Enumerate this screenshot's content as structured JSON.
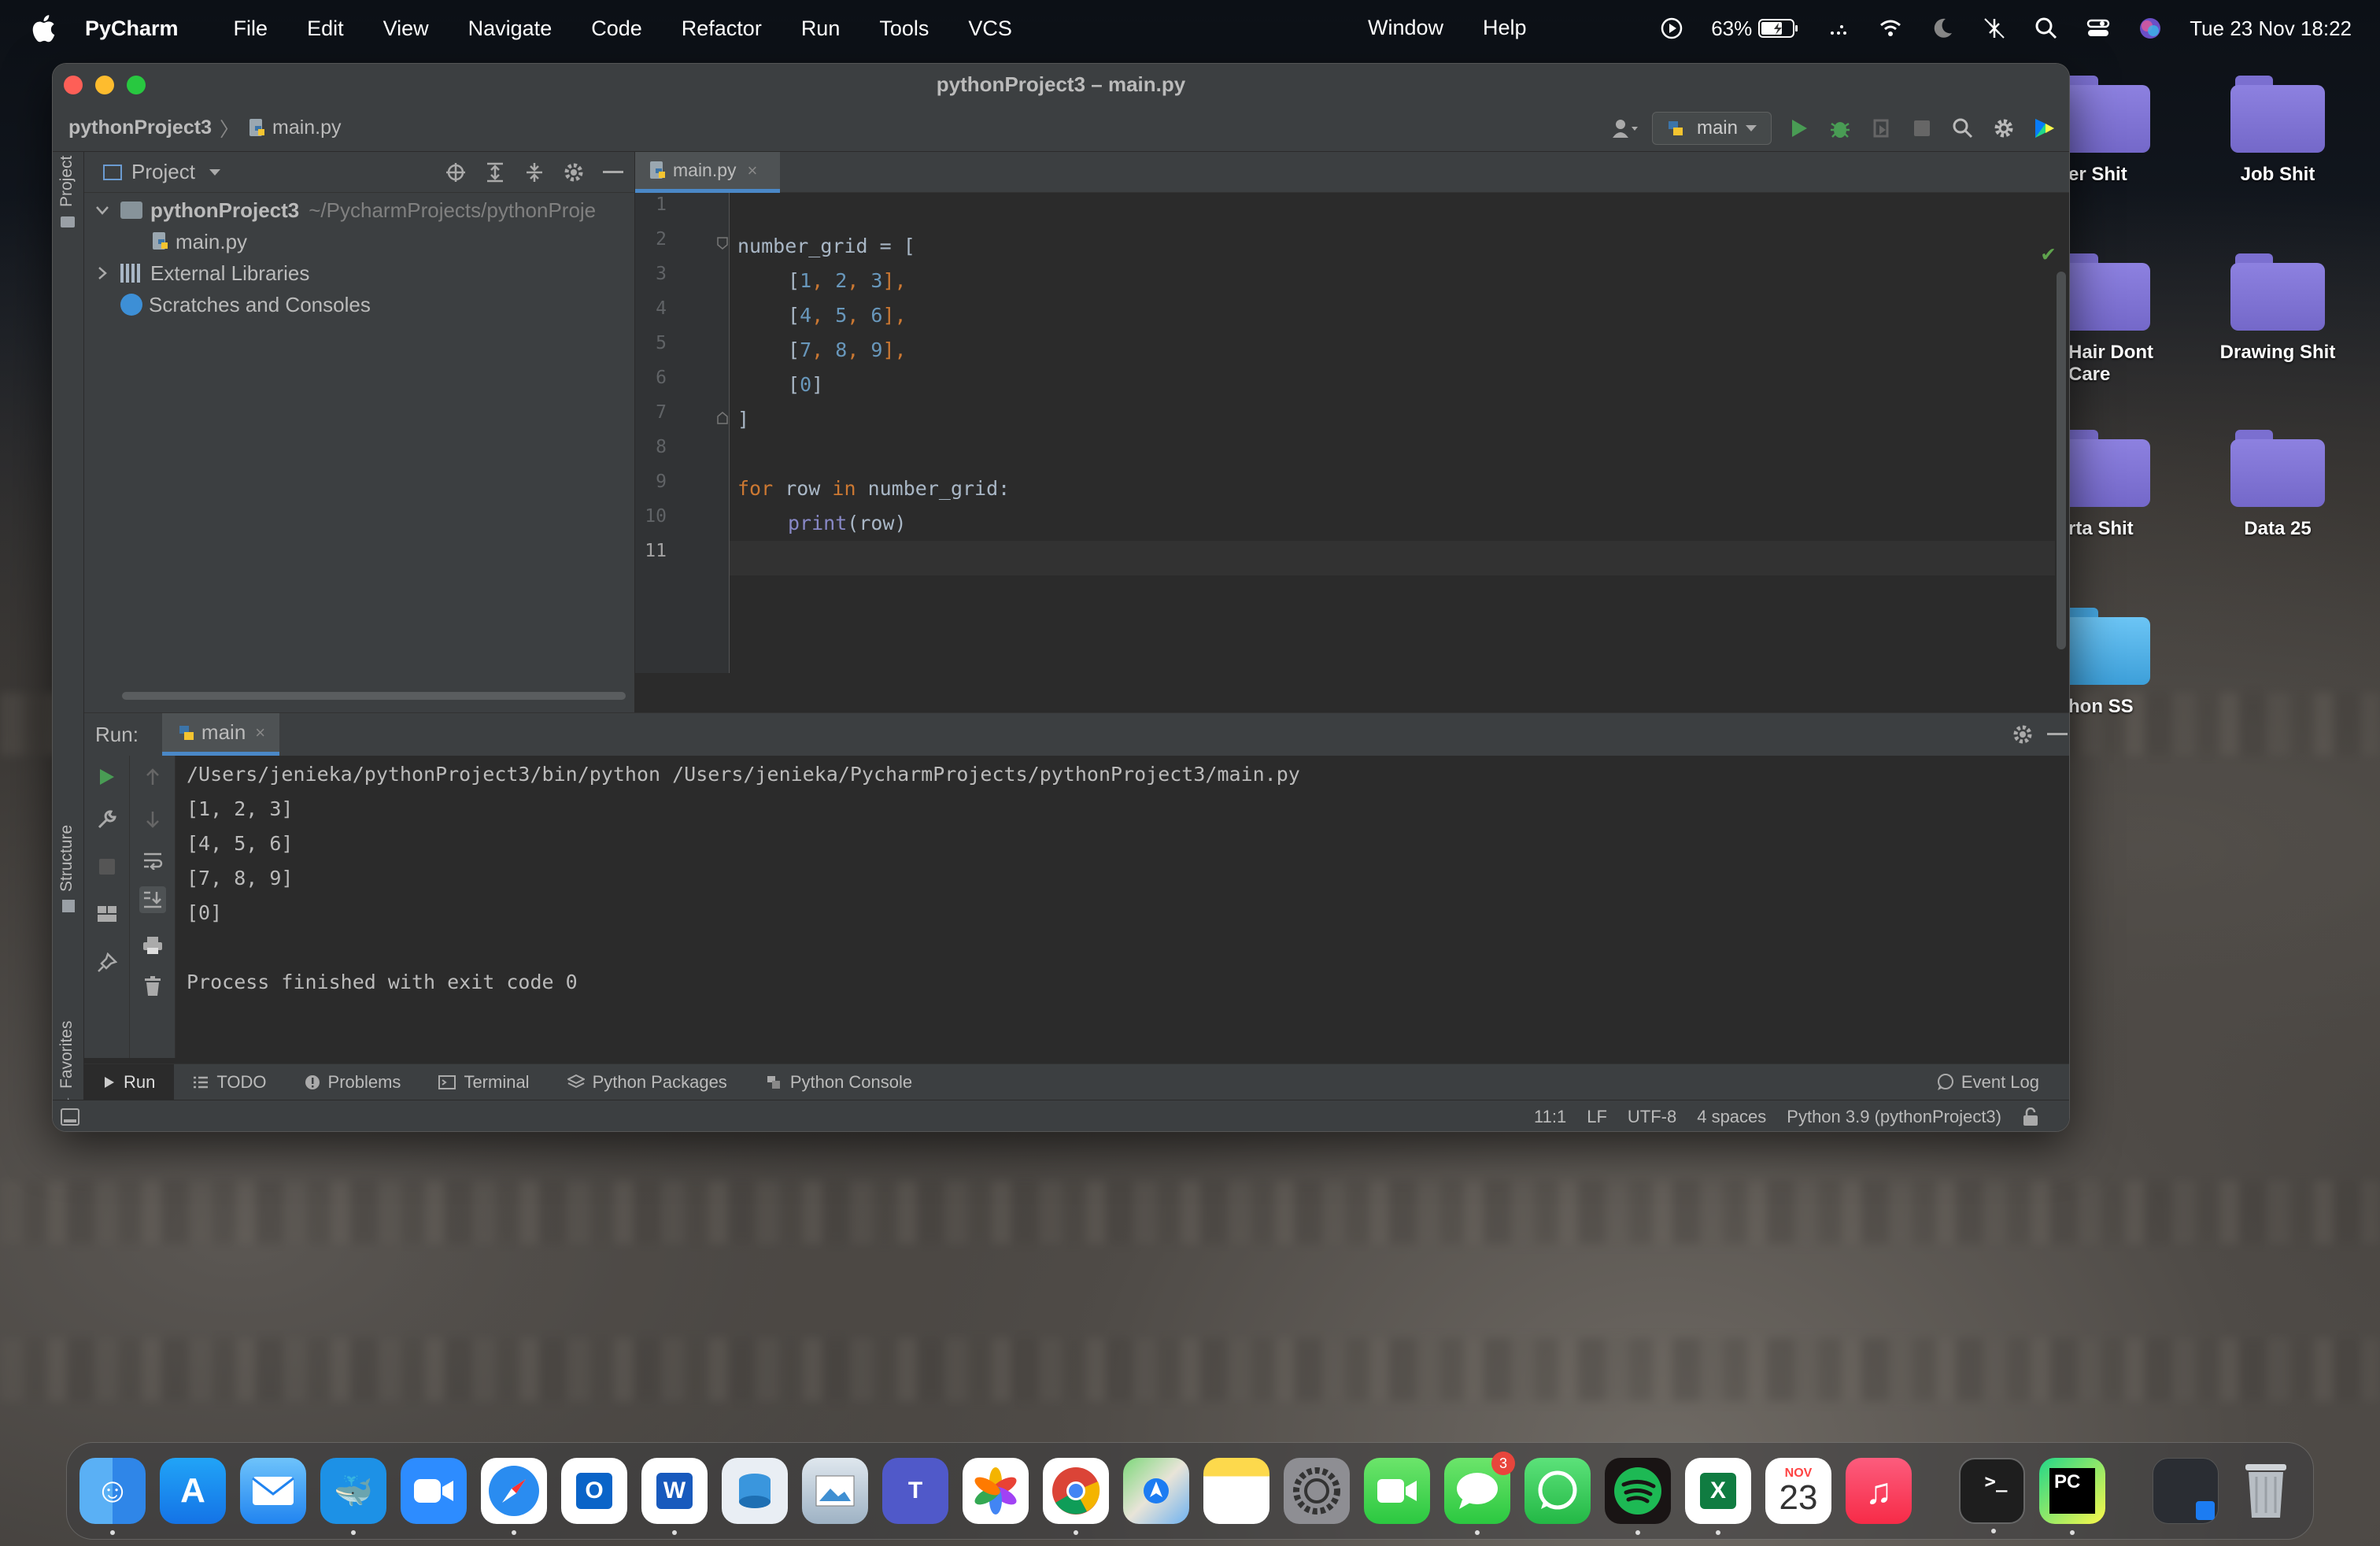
{
  "menubar": {
    "app_name": "PyCharm",
    "items": [
      "File",
      "Edit",
      "View",
      "Navigate",
      "Code",
      "Refactor",
      "Run",
      "Tools",
      "VCS"
    ],
    "window": "Window",
    "help": "Help",
    "battery": "63%",
    "datetime": "Tue 23 Nov  18:22"
  },
  "desktop": {
    "icons": [
      "er Shit",
      "Job Shit",
      "Hair Dont\nCare",
      "Drawing Shit",
      "rta Shit",
      "Data 25",
      "hon SS"
    ]
  },
  "window": {
    "title": "pythonProject3 – main.py",
    "breadcrumb": {
      "project": "pythonProject3",
      "file": "main.py"
    },
    "run_config": "main"
  },
  "left_stripe": {
    "project": "Project",
    "structure": "Structure",
    "favorites": "Favorites"
  },
  "project_panel": {
    "title": "Project",
    "root": "pythonProject3",
    "root_path": "~/PycharmProjects/pythonProje",
    "file": "main.py",
    "external": "External Libraries",
    "scratches": "Scratches and Consoles"
  },
  "editor": {
    "tab": "main.py",
    "line_numbers": [
      "1",
      "2",
      "3",
      "4",
      "5",
      "6",
      "7",
      "8",
      "9",
      "10",
      "11"
    ],
    "code": {
      "l2_var": "number_grid = [",
      "l3": [
        "[",
        "1",
        ", ",
        "2",
        ", ",
        "3",
        "],"
      ],
      "l4": [
        "[",
        "4",
        ", ",
        "5",
        ", ",
        "6",
        "],"
      ],
      "l5": [
        "[",
        "7",
        ", ",
        "8",
        ", ",
        "9",
        "],"
      ],
      "l6": [
        "[",
        "0",
        "]"
      ],
      "l7": "]",
      "l9_for": "for",
      "l9_mid": " row ",
      "l9_in": "in",
      "l9_end": " number_grid:",
      "l10_print": "print",
      "l10_args": "(row)"
    }
  },
  "run_panel": {
    "label": "Run:",
    "tab": "main",
    "output": [
      "/Users/jenieka/pythonProject3/bin/python /Users/jenieka/PycharmProjects/pythonProject3/main.py",
      "[1, 2, 3]",
      "[4, 5, 6]",
      "[7, 8, 9]",
      "[0]",
      "",
      "Process finished with exit code 0"
    ]
  },
  "bottom_tabs": [
    "Run",
    "TODO",
    "Problems",
    "Terminal",
    "Python Packages",
    "Python Console"
  ],
  "event_log": "Event Log",
  "statusbar": {
    "position": "11:1",
    "line_sep": "LF",
    "encoding": "UTF-8",
    "indent": "4 spaces",
    "interpreter": "Python 3.9 (pythonProject3)"
  },
  "dock": {
    "apps": [
      "Finder",
      "App Store",
      "Mail",
      "Docker",
      "Zoom",
      "Safari",
      "Outlook",
      "Word",
      "Azure Data Studio",
      "Preview",
      "Teams",
      "Photos",
      "Chrome",
      "Maps",
      "Notes",
      "System Preferences",
      "FaceTime",
      "Messages",
      "WhatsApp",
      "Spotify",
      "Excel",
      "Calendar",
      "Music"
    ],
    "calendar_month": "NOV",
    "calendar_day": "23",
    "messages_badge": "3",
    "pinned": [
      "Terminal",
      "PyCharm"
    ]
  },
  "colors": {
    "ide_bg": "#2b2b2b",
    "panel_bg": "#3c3f41",
    "keyword": "#cc7832",
    "number": "#6897bb",
    "builtin": "#8888c6",
    "accent": "#4a88c7",
    "folder_purple": "#7b6fd0"
  }
}
